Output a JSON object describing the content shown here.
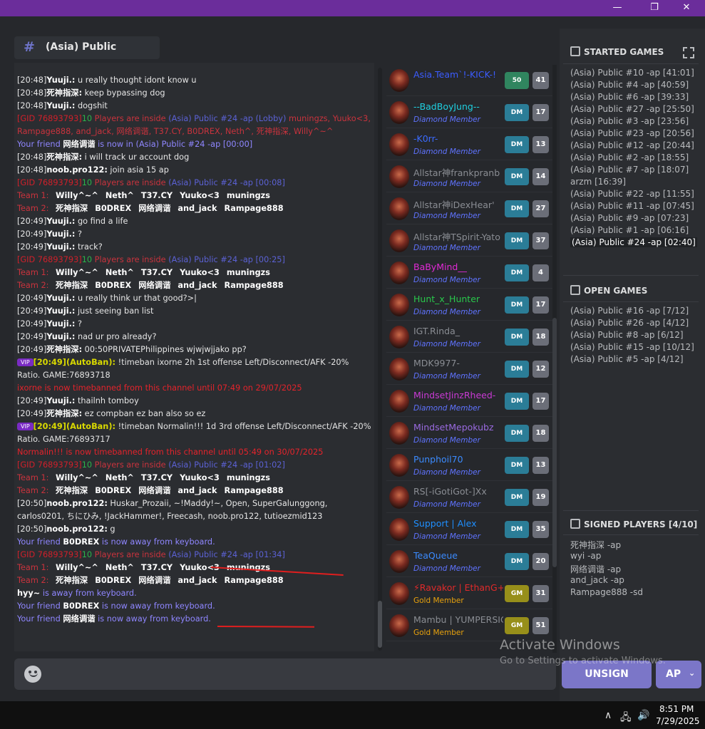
{
  "window": {
    "minimize": "—",
    "maximize": "❐",
    "close": "✕"
  },
  "channel": {
    "hash": "#",
    "name": "(Asia) Public"
  },
  "messages": [
    {
      "kind": "plain",
      "time": "[20:48]",
      "user": "Yuuji.:",
      "text": " u really thought idont know u"
    },
    {
      "kind": "plain",
      "time": "[20:48]",
      "user": "死神指深:",
      "text": " keep bypassing dog"
    },
    {
      "kind": "plain",
      "time": "[20:48]",
      "user": "Yuuji.:",
      "text": " dogshit"
    },
    {
      "kind": "lobby",
      "gid": "[GID 76893793]",
      "ten": "10",
      "mid": " Players are inside ",
      "game": "(Asia) Public #24 -ap (Lobby)",
      "players": " muningzs, Yuuko<3, Rampage888, and_jack, 网络调谐, T37.CY, B0DREX, Neth^, 死神指深, Willy^~^"
    },
    {
      "kind": "friend",
      "a": "Your friend ",
      "name": "网络调谐",
      "b": " is now in (Asia) Public #24 -ap [00:00]"
    },
    {
      "kind": "plain",
      "time": "[20:48]",
      "user": "死神指深:",
      "text": " i will track ur account dog"
    },
    {
      "kind": "plain",
      "time": "[20:48]",
      "user": "noob.pro122:",
      "text": " join asia 15 ap"
    },
    {
      "kind": "gid",
      "gid": "[GID 76893793]",
      "ten": "10",
      "mid": " Players are inside ",
      "game": "(Asia) Public #24 -ap [00:08]"
    },
    {
      "kind": "team",
      "label": "Team 1:",
      "players": [
        "Willy^~^",
        "Neth^",
        "T37.CY",
        "Yuuko<3",
        "muningzs"
      ]
    },
    {
      "kind": "team",
      "label": "Team 2:",
      "players": [
        "死神指深",
        "B0DREX",
        "网络调谐",
        "and_jack",
        "Rampage888"
      ]
    },
    {
      "kind": "plain",
      "time": "[20:49]",
      "user": "Yuuji.:",
      "text": " go find a life"
    },
    {
      "kind": "plain",
      "time": "[20:49]",
      "user": "Yuuji.:",
      "text": " ?"
    },
    {
      "kind": "plain",
      "time": "[20:49]",
      "user": "Yuuji.:",
      "text": " track?"
    },
    {
      "kind": "gid",
      "gid": "[GID 76893793]",
      "ten": "10",
      "mid": " Players are inside ",
      "game": "(Asia) Public #24 -ap [00:25]"
    },
    {
      "kind": "team",
      "label": "Team 1:",
      "players": [
        "Willy^~^",
        "Neth^",
        "T37.CY",
        "Yuuko<3",
        "muningzs"
      ]
    },
    {
      "kind": "team",
      "label": "Team 2:",
      "players": [
        "死神指深",
        "B0DREX",
        "网络调谐",
        "and_jack",
        "Rampage888"
      ]
    },
    {
      "kind": "plain",
      "time": "[20:49]",
      "user": "Yuuji.:",
      "text": " u really think ur that good?>|"
    },
    {
      "kind": "plain",
      "time": "[20:49]",
      "user": "Yuuji.:",
      "text": " just seeing ban list"
    },
    {
      "kind": "plain",
      "time": "[20:49]",
      "user": "Yuuji.:",
      "text": " ?"
    },
    {
      "kind": "plain",
      "time": "[20:49]",
      "user": "Yuuji.:",
      "text": " nad ur pro already?"
    },
    {
      "kind": "plain",
      "time": "[20:49]",
      "user": "死神指深:",
      "text": " 00:50PRIVATEPhilippines wjwjwjjako pp?"
    },
    {
      "kind": "auto",
      "vip": "VIP",
      "time": "[20:49]",
      "user": "(AutoBan):",
      "text": " !timeban ixorne 2h 1st offense Left/Disconnect/AFK -20% Ratio. GAME:76893718"
    },
    {
      "kind": "ban",
      "text": "ixorne is now timebanned from this channel until 07:49 on 29/07/2025"
    },
    {
      "kind": "plain",
      "time": "[20:49]",
      "user": "Yuuji.:",
      "text": " thailnh tomboy"
    },
    {
      "kind": "plain",
      "time": "[20:49]",
      "user": "死神指深:",
      "text": " ez compban ez ban also so ez"
    },
    {
      "kind": "auto",
      "vip": "VIP",
      "time": "[20:49]",
      "user": "(AutoBan):",
      "text": " !timeban Normalin!!! 1d 3rd offense Left/Disconnect/AFK -20% Ratio. GAME:76893717"
    },
    {
      "kind": "ban",
      "text": "Normalin!!! is now timebanned from this channel until 05:49 on 30/07/2025"
    },
    {
      "kind": "gid",
      "gid": "[GID 76893793]",
      "ten": "10",
      "mid": " Players are inside ",
      "game": "(Asia) Public #24 -ap [01:02]"
    },
    {
      "kind": "team",
      "label": "Team 1:",
      "players": [
        "Willy^~^",
        "Neth^",
        "T37.CY",
        "Yuuko<3",
        "muningzs"
      ]
    },
    {
      "kind": "team",
      "label": "Team 2:",
      "players": [
        "死神指深",
        "B0DREX",
        "网络调谐",
        "and_jack",
        "Rampage888"
      ]
    },
    {
      "kind": "plain",
      "time": "[20:50]",
      "user": "noob.pro122:",
      "text": " Huskar_Prozaii, ~!Maddy!~, Open, SuperGalunggong, carlos0201, ちにひみ, !JackHammer!, Freecash, noob.pro122, tutioezmid123"
    },
    {
      "kind": "plain",
      "time": "[20:50]",
      "user": "noob.pro122:",
      "text": " g"
    },
    {
      "kind": "friend",
      "a": "Your friend ",
      "name": "B0DREX",
      "b": " is now away from keyboard."
    },
    {
      "kind": "gid",
      "gid": "[GID 76893793]",
      "ten": "10",
      "mid": " Players are inside ",
      "game": "(Asia) Public #24 -ap [01:34]"
    },
    {
      "kind": "team",
      "label": "Team 1:",
      "players": [
        "Willy^~^",
        "Neth^",
        "T37.CY",
        "Yuuko<3",
        "muningzs"
      ]
    },
    {
      "kind": "team",
      "label": "Team 2:",
      "players": [
        "死神指深",
        "B0DREX",
        "网络调谐",
        "and_jack",
        "Rampage888"
      ]
    },
    {
      "kind": "away",
      "name": "hyy~",
      "b": " is away from keyboard."
    },
    {
      "kind": "friend",
      "a": "Your friend ",
      "name": "B0DREX",
      "b": " is now away from keyboard."
    },
    {
      "kind": "friend",
      "a": "Your friend ",
      "name": "网络调谐",
      "b": " is now away from keyboard."
    }
  ],
  "players": [
    {
      "name": "Asia.Team`!-KICK-!",
      "nameColor": "#3b5cff",
      "rank": "",
      "badge": "50",
      "badgeType": "b50",
      "count": "41"
    },
    {
      "name": "--BadBoyJung--",
      "nameColor": "#1fd0e0",
      "rank": "Diamond Member",
      "badge": "DM",
      "badgeType": "bdm",
      "count": "17"
    },
    {
      "name": "-K0rr-",
      "nameColor": "#3a6bff",
      "rank": "Diamond Member",
      "badge": "DM",
      "badgeType": "bdm",
      "count": "13"
    },
    {
      "name": "Allstar神frankpranb",
      "nameColor": "#8a8d93",
      "rank": "Diamond Member",
      "badge": "DM",
      "badgeType": "bdm",
      "count": "14"
    },
    {
      "name": "Allstar神iDexHear'",
      "nameColor": "#8a8d93",
      "rank": "Diamond Member",
      "badge": "DM",
      "badgeType": "bdm",
      "count": "27"
    },
    {
      "name": "Allstar神TSpirit-Yato",
      "nameColor": "#8a8d93",
      "rank": "Diamond Member",
      "badge": "DM",
      "badgeType": "bdm",
      "count": "37"
    },
    {
      "name": "BaByMind__",
      "nameColor": "#e22ad6",
      "rank": "Diamond Member",
      "badge": "DM",
      "badgeType": "bdm",
      "count": "4"
    },
    {
      "name": "Hunt_x_Hunter",
      "nameColor": "#29c94b",
      "rank": "Diamond Member",
      "badge": "DM",
      "badgeType": "bdm",
      "count": "17"
    },
    {
      "name": "IGT.Rinda_",
      "nameColor": "#8a8d93",
      "rank": "Diamond Member",
      "badge": "DM",
      "badgeType": "bdm",
      "count": "18"
    },
    {
      "name": "MDK9977-",
      "nameColor": "#8a8d93",
      "rank": "Diamond Member",
      "badge": "DM",
      "badgeType": "bdm",
      "count": "12"
    },
    {
      "name": "MindsetJinzRheed-",
      "nameColor": "#c93ad4",
      "rank": "Diamond Member",
      "badge": "DM",
      "badgeType": "bdm",
      "count": "17"
    },
    {
      "name": "MindsetMepokubz",
      "nameColor": "#9a6ae0",
      "rank": "Diamond Member",
      "badge": "DM",
      "badgeType": "bdm",
      "count": "18"
    },
    {
      "name": "Punphoil70",
      "nameColor": "#3b8bff",
      "rank": "Diamond Member",
      "badge": "DM",
      "badgeType": "bdm",
      "count": "13"
    },
    {
      "name": "RS[-iGotiGot-]Xx",
      "nameColor": "#8a8d93",
      "rank": "Diamond Member",
      "badge": "DM",
      "badgeType": "bdm",
      "count": "19"
    },
    {
      "name": "Support | Alex",
      "nameColor": "#1f8fff",
      "rank": "Diamond Member",
      "badge": "DM",
      "badgeType": "bdm",
      "count": "35"
    },
    {
      "name": "TeaQueue",
      "nameColor": "#3b8bff",
      "rank": "Diamond Member",
      "badge": "DM",
      "badgeType": "bdm",
      "count": "20"
    },
    {
      "name": "⚡Ravakor | EthanG+",
      "nameColor": "#e02a2a",
      "rank": "Gold Member",
      "badge": "GM",
      "badgeType": "bgm",
      "count": "31"
    },
    {
      "name": "Mambu | YUMPERSIC(",
      "nameColor": "#8a8d93",
      "rank": "Gold Member",
      "badge": "GM",
      "badgeType": "bgm",
      "count": "51"
    }
  ],
  "started": {
    "title": "STARTED GAMES",
    "games": [
      "(Asia) Public #10 -ap [41:01]",
      "(Asia) Public #4 -ap [40:59]",
      "(Asia) Public #6 -ap [39:33]",
      "(Asia) Public #27 -ap [25:50]",
      "(Asia) Public #3 -ap [23:56]",
      "(Asia) Public #23 -ap [20:56]",
      "(Asia) Public #12 -ap [20:44]",
      "(Asia) Public #2 -ap [18:55]",
      "(Asia) Public #7 -ap [18:07]",
      "arzm [16:39]",
      "(Asia) Public #22 -ap [11:55]",
      "(Asia) Public #11 -ap [07:45]",
      "(Asia) Public #9 -ap [07:23]",
      "(Asia) Public #1 -ap [06:16]",
      "(Asia) Public #24 -ap [02:40]"
    ]
  },
  "open": {
    "title": "OPEN GAMES",
    "games": [
      "(Asia) Public #16 -ap [7/12]",
      "(Asia) Public #26 -ap [4/12]",
      "(Asia) Public #8 -ap [6/12]",
      "(Asia) Public #15 -ap [10/12]",
      "(Asia) Public #5 -ap [4/12]"
    ]
  },
  "signed": {
    "title": "SIGNED PLAYERS [4/10]",
    "players": [
      "死神指深 -ap",
      "wyi -ap",
      "网络调谐 -ap",
      "and_jack -ap",
      "Rampage888 -sd"
    ]
  },
  "buttons": {
    "unsign": "UNSIGN",
    "mode": "AP",
    "mode_chevron": "⌄"
  },
  "watermark": {
    "title": "Activate Windows",
    "sub": "Go to Settings to activate Windows."
  },
  "taskbar": {
    "chevron": "∧",
    "network": "🖧",
    "volume": "🔊",
    "time": "8:51 PM",
    "date": "7/29/2025"
  },
  "colors": {
    "accent": "#7b76c8",
    "titlebar": "#6b2d9b"
  }
}
